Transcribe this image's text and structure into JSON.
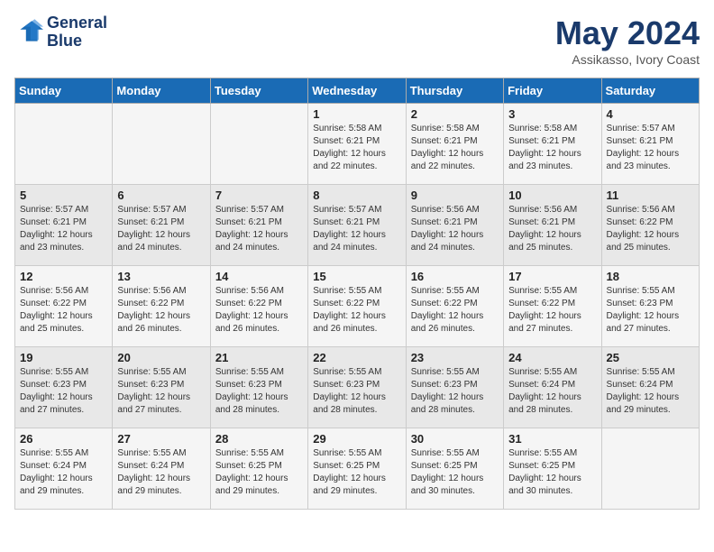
{
  "header": {
    "logo_line1": "General",
    "logo_line2": "Blue",
    "month": "May 2024",
    "location": "Assikasso, Ivory Coast"
  },
  "weekdays": [
    "Sunday",
    "Monday",
    "Tuesday",
    "Wednesday",
    "Thursday",
    "Friday",
    "Saturday"
  ],
  "weeks": [
    [
      {
        "day": "",
        "info": ""
      },
      {
        "day": "",
        "info": ""
      },
      {
        "day": "",
        "info": ""
      },
      {
        "day": "1",
        "info": "Sunrise: 5:58 AM\nSunset: 6:21 PM\nDaylight: 12 hours\nand 22 minutes."
      },
      {
        "day": "2",
        "info": "Sunrise: 5:58 AM\nSunset: 6:21 PM\nDaylight: 12 hours\nand 22 minutes."
      },
      {
        "day": "3",
        "info": "Sunrise: 5:58 AM\nSunset: 6:21 PM\nDaylight: 12 hours\nand 23 minutes."
      },
      {
        "day": "4",
        "info": "Sunrise: 5:57 AM\nSunset: 6:21 PM\nDaylight: 12 hours\nand 23 minutes."
      }
    ],
    [
      {
        "day": "5",
        "info": "Sunrise: 5:57 AM\nSunset: 6:21 PM\nDaylight: 12 hours\nand 23 minutes."
      },
      {
        "day": "6",
        "info": "Sunrise: 5:57 AM\nSunset: 6:21 PM\nDaylight: 12 hours\nand 24 minutes."
      },
      {
        "day": "7",
        "info": "Sunrise: 5:57 AM\nSunset: 6:21 PM\nDaylight: 12 hours\nand 24 minutes."
      },
      {
        "day": "8",
        "info": "Sunrise: 5:57 AM\nSunset: 6:21 PM\nDaylight: 12 hours\nand 24 minutes."
      },
      {
        "day": "9",
        "info": "Sunrise: 5:56 AM\nSunset: 6:21 PM\nDaylight: 12 hours\nand 24 minutes."
      },
      {
        "day": "10",
        "info": "Sunrise: 5:56 AM\nSunset: 6:21 PM\nDaylight: 12 hours\nand 25 minutes."
      },
      {
        "day": "11",
        "info": "Sunrise: 5:56 AM\nSunset: 6:22 PM\nDaylight: 12 hours\nand 25 minutes."
      }
    ],
    [
      {
        "day": "12",
        "info": "Sunrise: 5:56 AM\nSunset: 6:22 PM\nDaylight: 12 hours\nand 25 minutes."
      },
      {
        "day": "13",
        "info": "Sunrise: 5:56 AM\nSunset: 6:22 PM\nDaylight: 12 hours\nand 26 minutes."
      },
      {
        "day": "14",
        "info": "Sunrise: 5:56 AM\nSunset: 6:22 PM\nDaylight: 12 hours\nand 26 minutes."
      },
      {
        "day": "15",
        "info": "Sunrise: 5:55 AM\nSunset: 6:22 PM\nDaylight: 12 hours\nand 26 minutes."
      },
      {
        "day": "16",
        "info": "Sunrise: 5:55 AM\nSunset: 6:22 PM\nDaylight: 12 hours\nand 26 minutes."
      },
      {
        "day": "17",
        "info": "Sunrise: 5:55 AM\nSunset: 6:22 PM\nDaylight: 12 hours\nand 27 minutes."
      },
      {
        "day": "18",
        "info": "Sunrise: 5:55 AM\nSunset: 6:23 PM\nDaylight: 12 hours\nand 27 minutes."
      }
    ],
    [
      {
        "day": "19",
        "info": "Sunrise: 5:55 AM\nSunset: 6:23 PM\nDaylight: 12 hours\nand 27 minutes."
      },
      {
        "day": "20",
        "info": "Sunrise: 5:55 AM\nSunset: 6:23 PM\nDaylight: 12 hours\nand 27 minutes."
      },
      {
        "day": "21",
        "info": "Sunrise: 5:55 AM\nSunset: 6:23 PM\nDaylight: 12 hours\nand 28 minutes."
      },
      {
        "day": "22",
        "info": "Sunrise: 5:55 AM\nSunset: 6:23 PM\nDaylight: 12 hours\nand 28 minutes."
      },
      {
        "day": "23",
        "info": "Sunrise: 5:55 AM\nSunset: 6:23 PM\nDaylight: 12 hours\nand 28 minutes."
      },
      {
        "day": "24",
        "info": "Sunrise: 5:55 AM\nSunset: 6:24 PM\nDaylight: 12 hours\nand 28 minutes."
      },
      {
        "day": "25",
        "info": "Sunrise: 5:55 AM\nSunset: 6:24 PM\nDaylight: 12 hours\nand 29 minutes."
      }
    ],
    [
      {
        "day": "26",
        "info": "Sunrise: 5:55 AM\nSunset: 6:24 PM\nDaylight: 12 hours\nand 29 minutes."
      },
      {
        "day": "27",
        "info": "Sunrise: 5:55 AM\nSunset: 6:24 PM\nDaylight: 12 hours\nand 29 minutes."
      },
      {
        "day": "28",
        "info": "Sunrise: 5:55 AM\nSunset: 6:25 PM\nDaylight: 12 hours\nand 29 minutes."
      },
      {
        "day": "29",
        "info": "Sunrise: 5:55 AM\nSunset: 6:25 PM\nDaylight: 12 hours\nand 29 minutes."
      },
      {
        "day": "30",
        "info": "Sunrise: 5:55 AM\nSunset: 6:25 PM\nDaylight: 12 hours\nand 30 minutes."
      },
      {
        "day": "31",
        "info": "Sunrise: 5:55 AM\nSunset: 6:25 PM\nDaylight: 12 hours\nand 30 minutes."
      },
      {
        "day": "",
        "info": ""
      }
    ]
  ]
}
